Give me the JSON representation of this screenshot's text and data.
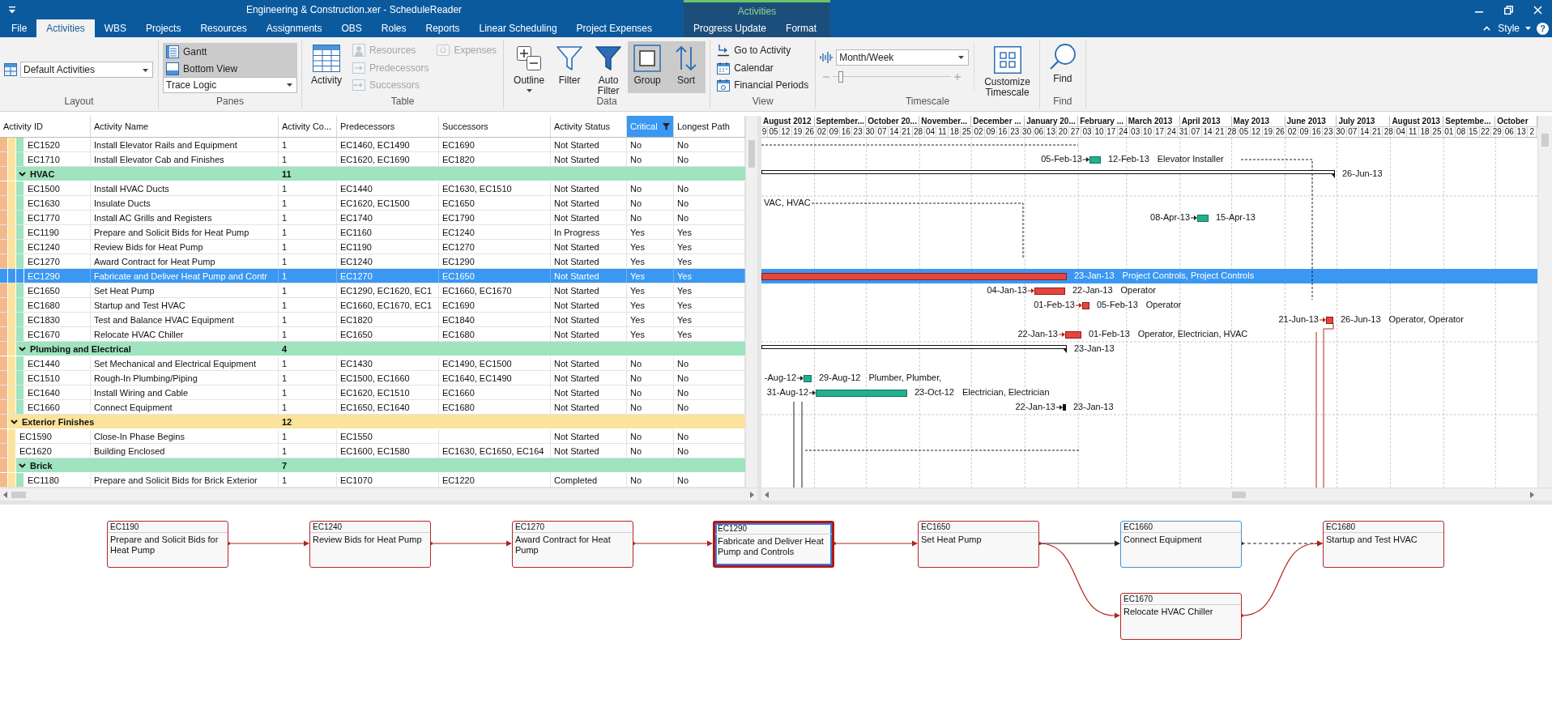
{
  "window": {
    "title": "Engineering & Construction.xer - ScheduleReader",
    "context_group": "Activities"
  },
  "tabs": [
    {
      "label": "File",
      "selected": false,
      "context": false
    },
    {
      "label": "Activities",
      "selected": true,
      "context": false
    },
    {
      "label": "WBS",
      "selected": false,
      "context": false
    },
    {
      "label": "Projects",
      "selected": false,
      "context": false
    },
    {
      "label": "Resources",
      "selected": false,
      "context": false
    },
    {
      "label": "Assignments",
      "selected": false,
      "context": false
    },
    {
      "label": "OBS",
      "selected": false,
      "context": false
    },
    {
      "label": "Roles",
      "selected": false,
      "context": false
    },
    {
      "label": "Reports",
      "selected": false,
      "context": false
    },
    {
      "label": "Linear Scheduling",
      "selected": false,
      "context": false
    },
    {
      "label": "Project Expenses",
      "selected": false,
      "context": false
    },
    {
      "label": "Progress Update",
      "selected": false,
      "context": true
    },
    {
      "label": "Format",
      "selected": false,
      "context": true
    }
  ],
  "ribbon_options": {
    "style": "Style",
    "help": "?"
  },
  "ribbon": [
    {
      "kind": "layout",
      "label": "Layout",
      "dropdown": "Default Activities"
    },
    {
      "kind": "panes",
      "label": "Panes",
      "toggles": [
        {
          "label": "Gantt",
          "on": true
        },
        {
          "label": "Bottom View",
          "on": true
        }
      ],
      "dropdown": "Trace Logic"
    },
    {
      "kind": "table",
      "label": "Table",
      "buttons": [
        {
          "kind": "large",
          "label": "Activity",
          "disabled": false
        },
        {
          "kind": "small",
          "label": "Resources",
          "disabled": true
        },
        {
          "kind": "small",
          "label": "Predecessors",
          "disabled": true
        },
        {
          "kind": "small",
          "label": "Successors",
          "disabled": true
        },
        {
          "kind": "small",
          "label": "Expenses",
          "disabled": true
        }
      ]
    },
    {
      "kind": "data",
      "label": "Data",
      "buttons": [
        {
          "label": "Outline",
          "on": false,
          "menu": true
        },
        {
          "label": "Filter",
          "on": false,
          "menu": false
        },
        {
          "label": "Auto Filter",
          "on": false,
          "menu": false
        },
        {
          "label": "Group",
          "on": true,
          "menu": false
        },
        {
          "label": "Sort",
          "on": true,
          "menu": false
        }
      ]
    },
    {
      "kind": "view",
      "label": "View",
      "buttons": [
        {
          "label": "Go to Activity"
        },
        {
          "label": "Calendar"
        },
        {
          "label": "Financial Periods"
        }
      ]
    },
    {
      "kind": "timescale",
      "label": "Timescale",
      "dropdown": "Month/Week",
      "level": 0.07,
      "button": "Customize Timescale"
    },
    {
      "kind": "find",
      "label": "Find",
      "button": "Find"
    }
  ],
  "table": {
    "columns": [
      {
        "label": "Activity ID",
        "filtered": false
      },
      {
        "label": "Activity Name",
        "filtered": false
      },
      {
        "label": "Activity Co...",
        "filtered": false
      },
      {
        "label": "Predecessors",
        "filtered": false
      },
      {
        "label": "Successors",
        "filtered": false
      },
      {
        "label": "Activity Status",
        "filtered": false
      },
      {
        "label": "Critical",
        "filtered": true
      },
      {
        "label": "Longest Path",
        "filtered": false
      }
    ],
    "rows": [
      {
        "kind": "group",
        "children": [
          {
            "kind": "group",
            "children": [
              {
                "kind": "group",
                "children": [
                  {
                    "kind": "activity",
                    "id": "EC1520",
                    "name": "Install Elevator Rails and Equipment",
                    "count": "1",
                    "predecessors": "EC1460, EC1490",
                    "successors": "EC1690",
                    "status": "Not Started",
                    "critical": "No",
                    "longest_path": "No",
                    "selected": false
                  },
                  {
                    "kind": "activity",
                    "id": "EC1710",
                    "name": "Install Elevator Cab and Finishes",
                    "count": "1",
                    "predecessors": "EC1620, EC1690",
                    "successors": "EC1820",
                    "status": "Not Started",
                    "critical": "No",
                    "longest_path": "No",
                    "selected": false
                  }
                ]
              },
              {
                "kind": "group",
                "name": "HVAC",
                "count": "11",
                "expanded": true,
                "children": [
                  {
                    "kind": "activity",
                    "id": "EC1500",
                    "name": "Install HVAC Ducts",
                    "count": "1",
                    "predecessors": "EC1440",
                    "successors": "EC1630, EC1510",
                    "status": "Not Started",
                    "critical": "No",
                    "longest_path": "No",
                    "selected": false
                  },
                  {
                    "kind": "activity",
                    "id": "EC1630",
                    "name": "Insulate Ducts",
                    "count": "1",
                    "predecessors": "EC1620, EC1500",
                    "successors": "EC1650",
                    "status": "Not Started",
                    "critical": "No",
                    "longest_path": "No",
                    "selected": false
                  },
                  {
                    "kind": "activity",
                    "id": "EC1770",
                    "name": "Install AC Grills and Registers",
                    "count": "1",
                    "predecessors": "EC1740",
                    "successors": "EC1790",
                    "status": "Not Started",
                    "critical": "No",
                    "longest_path": "No",
                    "selected": false
                  },
                  {
                    "kind": "activity",
                    "id": "EC1190",
                    "name": "Prepare and Solicit Bids for Heat Pump",
                    "count": "1",
                    "predecessors": "EC1160",
                    "successors": "EC1240",
                    "status": "In Progress",
                    "critical": "Yes",
                    "longest_path": "Yes",
                    "selected": false
                  },
                  {
                    "kind": "activity",
                    "id": "EC1240",
                    "name": "Review Bids for Heat Pump",
                    "count": "1",
                    "predecessors": "EC1190",
                    "successors": "EC1270",
                    "status": "Not Started",
                    "critical": "Yes",
                    "longest_path": "Yes",
                    "selected": false
                  },
                  {
                    "kind": "activity",
                    "id": "EC1270",
                    "name": "Award Contract for Heat Pump",
                    "count": "1",
                    "predecessors": "EC1240",
                    "successors": "EC1290",
                    "status": "Not Started",
                    "critical": "Yes",
                    "longest_path": "Yes",
                    "selected": false
                  },
                  {
                    "kind": "activity",
                    "id": "EC1290",
                    "name": "Fabricate and Deliver Heat Pump and Contr",
                    "count": "1",
                    "predecessors": "EC1270",
                    "successors": "EC1650",
                    "status": "Not Started",
                    "critical": "Yes",
                    "longest_path": "Yes",
                    "selected": true
                  },
                  {
                    "kind": "activity",
                    "id": "EC1650",
                    "name": "Set Heat Pump",
                    "count": "1",
                    "predecessors": "EC1290, EC1620, EC1",
                    "successors": "EC1660, EC1670",
                    "status": "Not Started",
                    "critical": "Yes",
                    "longest_path": "Yes",
                    "selected": false
                  },
                  {
                    "kind": "activity",
                    "id": "EC1680",
                    "name": "Startup and Test HVAC",
                    "count": "1",
                    "predecessors": "EC1660, EC1670, EC1",
                    "successors": "EC1690",
                    "status": "Not Started",
                    "critical": "Yes",
                    "longest_path": "Yes",
                    "selected": false
                  },
                  {
                    "kind": "activity",
                    "id": "EC1830",
                    "name": "Test and Balance HVAC Equipment",
                    "count": "1",
                    "predecessors": "EC1820",
                    "successors": "EC1840",
                    "status": "Not Started",
                    "critical": "Yes",
                    "longest_path": "Yes",
                    "selected": false
                  },
                  {
                    "kind": "activity",
                    "id": "EC1670",
                    "name": "Relocate HVAC Chiller",
                    "count": "1",
                    "predecessors": "EC1650",
                    "successors": "EC1680",
                    "status": "Not Started",
                    "critical": "Yes",
                    "longest_path": "Yes",
                    "selected": false
                  }
                ]
              },
              {
                "kind": "group",
                "name": "Plumbing and Electrical",
                "count": "4",
                "expanded": true,
                "children": [
                  {
                    "kind": "activity",
                    "id": "EC1440",
                    "name": "Set Mechanical and Electrical Equipment",
                    "count": "1",
                    "predecessors": "EC1430",
                    "successors": "EC1490, EC1500",
                    "status": "Not Started",
                    "critical": "No",
                    "longest_path": "No",
                    "selected": false
                  },
                  {
                    "kind": "activity",
                    "id": "EC1510",
                    "name": "Rough-In Plumbing/Piping",
                    "count": "1",
                    "predecessors": "EC1500, EC1660",
                    "successors": "EC1640, EC1490",
                    "status": "Not Started",
                    "critical": "No",
                    "longest_path": "No",
                    "selected": false
                  },
                  {
                    "kind": "activity",
                    "id": "EC1640",
                    "name": "Install Wiring and Cable",
                    "count": "1",
                    "predecessors": "EC1620, EC1510",
                    "successors": "EC1660",
                    "status": "Not Started",
                    "critical": "No",
                    "longest_path": "No",
                    "selected": false
                  },
                  {
                    "kind": "activity",
                    "id": "EC1660",
                    "name": "Connect Equipment",
                    "count": "1",
                    "predecessors": "EC1650, EC1640",
                    "successors": "EC1680",
                    "status": "Not Started",
                    "critical": "No",
                    "longest_path": "No",
                    "selected": false
                  }
                ]
              }
            ]
          },
          {
            "kind": "group",
            "name": "Exterior Finishes",
            "count": "12",
            "expanded": true,
            "children": [
              {
                "kind": "activity",
                "id": "EC1590",
                "name": "Close-In Phase Begins",
                "count": "1",
                "predecessors": "EC1550",
                "status": "Not Started",
                "critical": "No",
                "longest_path": "No",
                "selected": false
              },
              {
                "kind": "activity",
                "id": "EC1620",
                "name": "Building Enclosed",
                "count": "1",
                "predecessors": "EC1600, EC1580",
                "successors": "EC1630, EC1650, EC164",
                "status": "Not Started",
                "critical": "No",
                "longest_path": "No",
                "selected": false
              },
              {
                "kind": "group",
                "name": "Brick",
                "count": "7",
                "expanded": true,
                "children": [
                  {
                    "kind": "activity",
                    "id": "EC1180",
                    "name": "Prepare and Solicit Bids for Brick Exterior",
                    "count": "1",
                    "predecessors": "EC1070",
                    "successors": "EC1220",
                    "status": "Completed",
                    "critical": "No",
                    "longest_path": "No",
                    "selected": false
                  }
                ]
              }
            ]
          }
        ]
      }
    ]
  },
  "gantt": {
    "months": [
      "August 2012",
      "September...",
      "October 20...",
      "November...",
      "December ...",
      "January 20...",
      "February ...",
      "March 2013",
      "April 2013",
      "May 2013",
      "June 2013",
      "July 2013",
      "August 2013",
      "Septembe...",
      "October"
    ],
    "weeks": [
      "9",
      "05",
      "12",
      "19",
      "26",
      "02",
      "09",
      "16",
      "23",
      "30",
      "07",
      "14",
      "21",
      "28",
      "04",
      "11",
      "18",
      "25",
      "02",
      "09",
      "16",
      "23",
      "30",
      "06",
      "13",
      "20",
      "27",
      "03",
      "10",
      "17",
      "24",
      "03",
      "10",
      "17",
      "24",
      "31",
      "07",
      "14",
      "21",
      "28",
      "05",
      "12",
      "19",
      "26",
      "02",
      "09",
      "16",
      "23",
      "30",
      "07",
      "14",
      "21",
      "28",
      "04",
      "11",
      "18",
      "25",
      "01",
      "08",
      "15",
      "22",
      "29",
      "06",
      "13",
      "2"
    ],
    "bars": [
      {
        "kind": "task",
        "critical": false,
        "start": "05-Feb-13",
        "finish": "12-Feb-13",
        "resources": "Elevator Installer"
      },
      {
        "kind": "summary",
        "finish": "26-Jun-13"
      },
      {
        "kind": "offscreen",
        "resources": "VAC, HVAC"
      },
      {
        "kind": "task",
        "critical": false,
        "start": "08-Apr-13",
        "finish": "15-Apr-13"
      },
      {
        "kind": "task",
        "critical": true,
        "finish": "23-Jan-13",
        "resources": "Project Controls, Project Controls"
      },
      {
        "kind": "task",
        "critical": true,
        "start": "04-Jan-13",
        "finish": "22-Jan-13",
        "resources": "Operator"
      },
      {
        "kind": "task",
        "critical": true,
        "start": "01-Feb-13",
        "finish": "05-Feb-13",
        "resources": "Operator"
      },
      {
        "kind": "task",
        "critical": true,
        "start": "21-Jun-13",
        "finish": "26-Jun-13",
        "resources": "Operator, Operator"
      },
      {
        "kind": "task",
        "critical": true,
        "start": "22-Jan-13",
        "finish": "01-Feb-13",
        "resources": "Operator, Electrician, HVAC"
      },
      {
        "kind": "summary",
        "finish": "23-Jan-13"
      },
      {
        "kind": "task",
        "critical": false,
        "start": "-Aug-12",
        "finish": "29-Aug-12",
        "resources": "Plumber, Plumber,"
      },
      {
        "kind": "task",
        "critical": false,
        "start": "31-Aug-12",
        "finish": "23-Oct-12",
        "resources": "Electrician, Electrician"
      },
      {
        "kind": "milestone",
        "start": "22-Jan-13",
        "finish": "23-Jan-13"
      }
    ]
  },
  "network": {
    "nodes": [
      {
        "id": "EC1190",
        "name": "Prepare and Solicit Bids for Heat Pump",
        "critical": true,
        "selected": false
      },
      {
        "id": "EC1240",
        "name": "Review Bids for Heat Pump",
        "critical": true,
        "selected": false
      },
      {
        "id": "EC1270",
        "name": "Award Contract for Heat Pump",
        "critical": true,
        "selected": false
      },
      {
        "id": "EC1290",
        "name": "Fabricate and Deliver Heat Pump and Controls",
        "critical": true,
        "selected": true
      },
      {
        "id": "EC1650",
        "name": "Set Heat Pump",
        "critical": true,
        "selected": false
      },
      {
        "id": "EC1660",
        "name": "Connect Equipment",
        "critical": false,
        "selected": false
      },
      {
        "id": "EC1680",
        "name": "Startup and Test HVAC",
        "critical": true,
        "selected": false
      },
      {
        "id": "EC1670",
        "name": "Relocate HVAC Chiller",
        "critical": true,
        "selected": false
      }
    ],
    "links": [
      {
        "critical": true,
        "dashed": false
      },
      {
        "critical": true,
        "dashed": false
      },
      {
        "critical": true,
        "dashed": false
      },
      {
        "critical": true,
        "dashed": false
      },
      {
        "critical": false,
        "dashed": false
      },
      {
        "critical": false,
        "dashed": true
      },
      {
        "critical": true,
        "dashed": false
      },
      {
        "critical": true,
        "dashed": false
      }
    ]
  }
}
